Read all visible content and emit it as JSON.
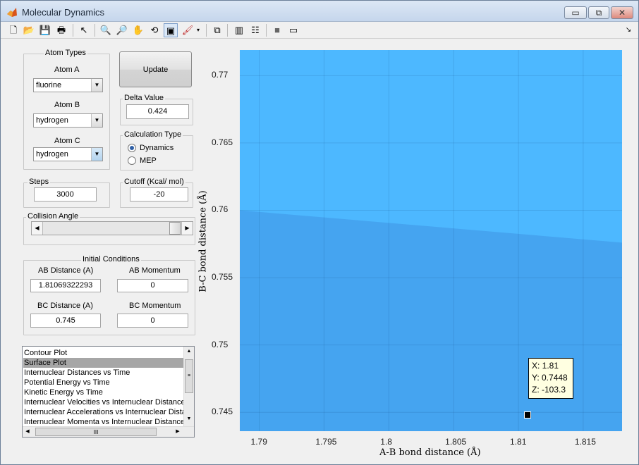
{
  "window": {
    "title": "Molecular Dynamics",
    "minimize": "▭",
    "restore": "⧉",
    "close": "✕"
  },
  "toolbar": {
    "icons": [
      "new-file-icon",
      "open-folder-icon",
      "save-icon",
      "print-icon",
      "pointer-icon",
      "zoom-in-icon",
      "zoom-out-icon",
      "pan-icon",
      "rotate-icon",
      "data-cursor-icon",
      "brush-icon",
      "brush-dropdown-icon",
      "link-plot-icon",
      "colorbar-icon",
      "legend-icon",
      "hide-plot-tools-icon",
      "show-plot-tools-icon",
      "dock-icon"
    ]
  },
  "atom_types": {
    "title": "Atom Types",
    "atom_a_label": "Atom A",
    "atom_a_value": "fluorine",
    "atom_b_label": "Atom B",
    "atom_b_value": "hydrogen",
    "atom_c_label": "Atom C",
    "atom_c_value": "hydrogen"
  },
  "update_button": "Update",
  "delta": {
    "title": "Delta Value",
    "value": "0.424"
  },
  "calc_type": {
    "title": "Calculation Type",
    "option1": "Dynamics",
    "option2": "MEP",
    "selected": "Dynamics"
  },
  "steps": {
    "title": "Steps",
    "value": "3000"
  },
  "cutoff": {
    "title": "Cutoff (Kcal/ mol)",
    "value": "-20"
  },
  "collision": {
    "title": "Collision Angle",
    "slider_fraction": 1.0
  },
  "initial": {
    "title": "Initial Conditions",
    "ab_dist_label": "AB Distance (A)",
    "ab_dist_value": "1.81069322293",
    "ab_mom_label": "AB Momentum",
    "ab_mom_value": "0",
    "bc_dist_label": "BC Distance (A)",
    "bc_dist_value": "0.745",
    "bc_mom_label": "BC Momentum",
    "bc_mom_value": "0"
  },
  "plot_list": {
    "items": [
      "Contour Plot",
      "Surface Plot",
      "Internuclear Distances vs Time",
      "Potential Energy vs Time",
      "Kinetic Energy vs Time",
      "Internuclear Velocities vs Internuclear Distances",
      "Internuclear Accelerations vs Internuclear Distances",
      "Internuclear Momenta vs Internuclear Distances"
    ],
    "selected_index": 1,
    "scroll_up": "▲",
    "scroll_down": "▼",
    "scroll_left": "◀",
    "scroll_right": "▶",
    "hgrip": "III"
  },
  "plot": {
    "xlabel": "A-B bond distance (Å)",
    "ylabel": "B-C bond distance (Å)",
    "xticks": [
      "1.79",
      "1.795",
      "1.8",
      "1.805",
      "1.81",
      "1.815"
    ],
    "yticks": [
      "0.77",
      "0.765",
      "0.76",
      "0.755",
      "0.75",
      "0.745"
    ],
    "xlim": [
      1.7885,
      1.818
    ],
    "ylim": [
      0.7436,
      0.7719
    ],
    "upper_color": "#4db8ff",
    "lower_color": "#45a4f0",
    "datatip": {
      "x_text": "X: 1.81",
      "y_text": "Y: 0.7448",
      "z_text": "Z: -103.3",
      "x": 1.8107,
      "y": 0.7448
    }
  }
}
